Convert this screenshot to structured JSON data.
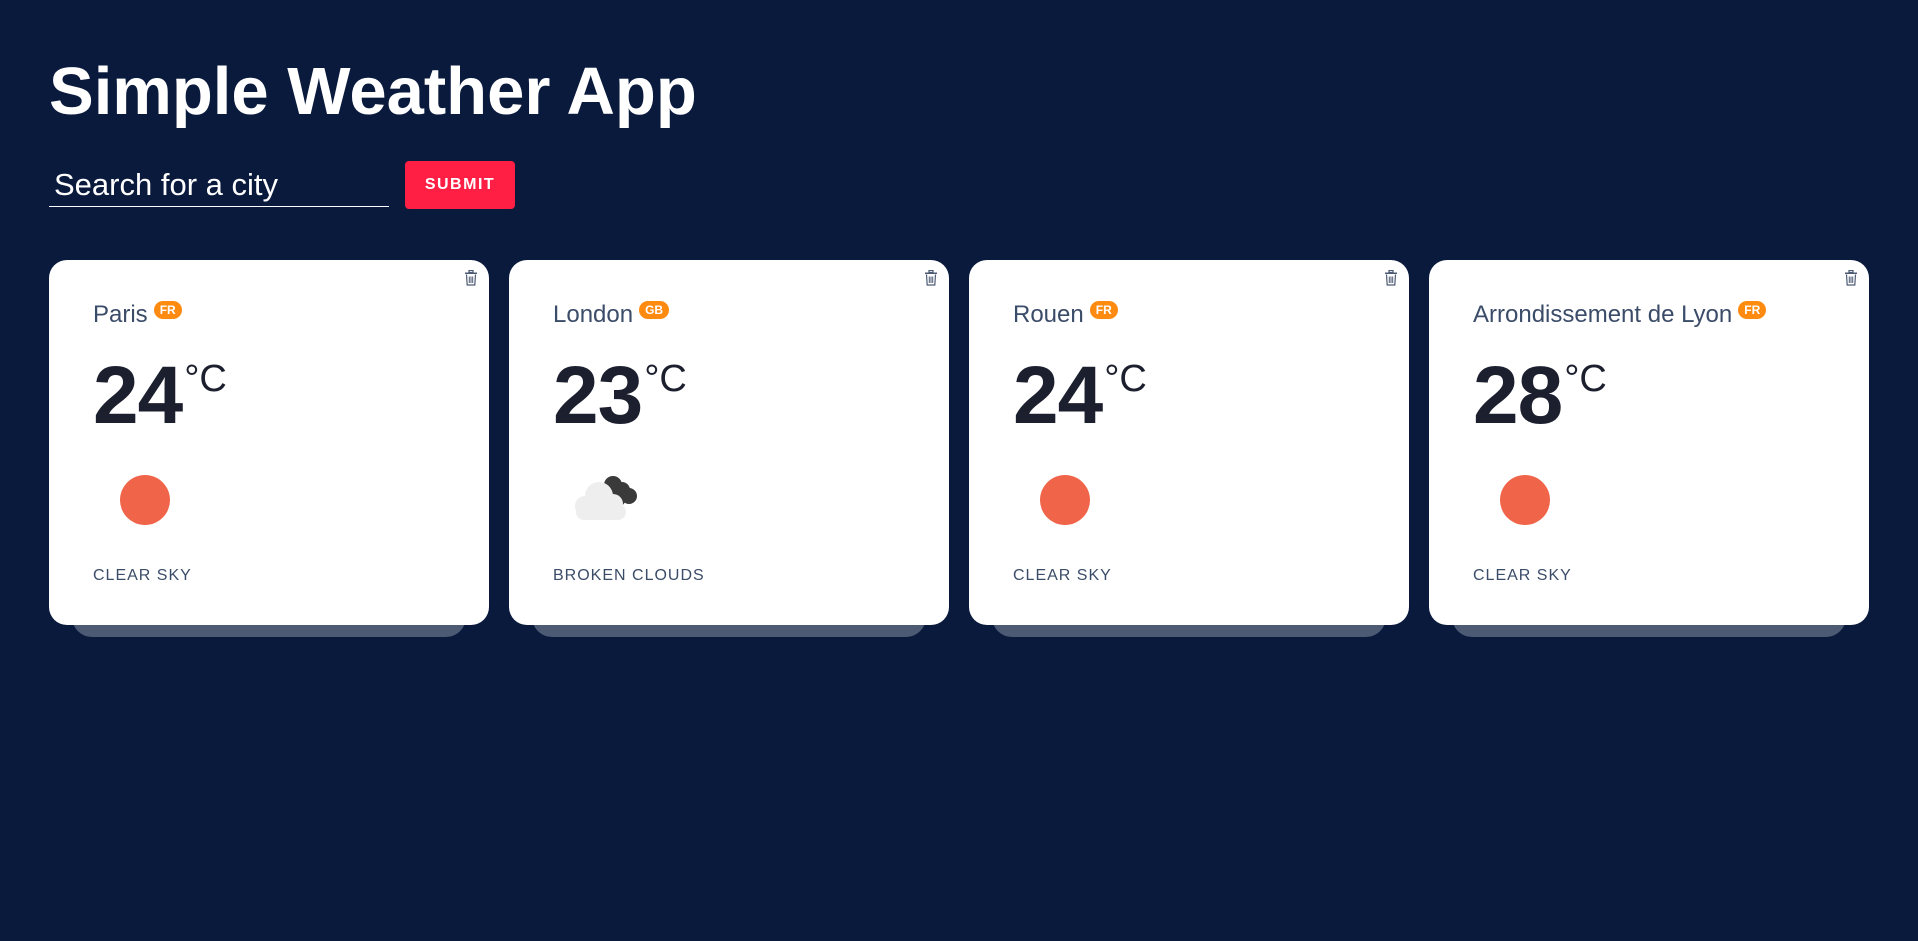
{
  "app": {
    "title": "Simple Weather App"
  },
  "search": {
    "placeholder": "Search for a city",
    "value": "",
    "submit_label": "SUBMIT"
  },
  "colors": {
    "background": "#0a1a3d",
    "accent": "#ff1f45",
    "badge": "#ff8a10",
    "sun": "#f0654a"
  },
  "cards": [
    {
      "city": "Paris",
      "country": "FR",
      "temp": "24",
      "unit": "°C",
      "condition": "CLEAR SKY",
      "icon": "sun-icon"
    },
    {
      "city": "London",
      "country": "GB",
      "temp": "23",
      "unit": "°C",
      "condition": "BROKEN CLOUDS",
      "icon": "broken-clouds-icon"
    },
    {
      "city": "Rouen",
      "country": "FR",
      "temp": "24",
      "unit": "°C",
      "condition": "CLEAR SKY",
      "icon": "sun-icon"
    },
    {
      "city": "Arrondissement de Lyon",
      "country": "FR",
      "temp": "28",
      "unit": "°C",
      "condition": "CLEAR SKY",
      "icon": "sun-icon"
    }
  ]
}
